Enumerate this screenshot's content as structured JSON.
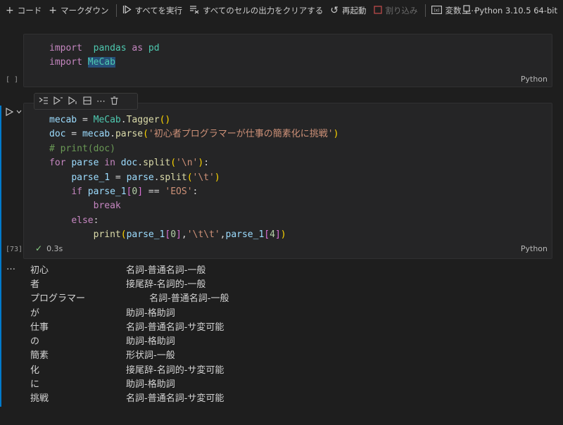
{
  "toolbar": {
    "code": "コード",
    "markdown": "マークダウン",
    "run_all": "すべてを実行",
    "clear_outputs": "すべてのセルの出力をクリアする",
    "restart": "再起動",
    "interrupt": "割り込み",
    "variables": "変数",
    "more": "⋯",
    "kernel": "Python 3.10.5 64-bit"
  },
  "cells": [
    {
      "exec_label": "[ ]",
      "language": "Python",
      "lines": [
        [
          [
            "kw",
            "import"
          ],
          [
            "",
            "  "
          ],
          [
            "mod",
            "pandas"
          ],
          [
            "",
            " "
          ],
          [
            "kw",
            "as"
          ],
          [
            "",
            " "
          ],
          [
            "mod",
            "pd"
          ]
        ],
        [
          [
            "kw",
            "import"
          ],
          [
            "",
            " "
          ],
          [
            "mod hl",
            "MeCab"
          ]
        ]
      ]
    },
    {
      "exec_label": "[73]",
      "language": "Python",
      "status_icon": "✓",
      "duration": "0.3s",
      "lines": [
        [
          [
            "var",
            "mecab"
          ],
          [
            "",
            " = "
          ],
          [
            "mod",
            "MeCab"
          ],
          [
            "",
            "."
          ],
          [
            "fn",
            "Tagger"
          ],
          [
            "br",
            "()"
          ]
        ],
        [
          [
            "var",
            "doc"
          ],
          [
            "",
            " = "
          ],
          [
            "var",
            "mecab"
          ],
          [
            "",
            "."
          ],
          [
            "fn",
            "parse"
          ],
          [
            "br",
            "("
          ],
          [
            "str",
            "'初心者プログラマーが仕事の簡素化に挑戦'"
          ],
          [
            "br",
            ")"
          ]
        ],
        [
          [
            "cm",
            "# print(doc)"
          ]
        ],
        [
          [
            "kw",
            "for"
          ],
          [
            "",
            " "
          ],
          [
            "var",
            "parse"
          ],
          [
            "",
            " "
          ],
          [
            "kw",
            "in"
          ],
          [
            "",
            " "
          ],
          [
            "var",
            "doc"
          ],
          [
            "",
            "."
          ],
          [
            "fn",
            "split"
          ],
          [
            "br",
            "("
          ],
          [
            "str",
            "'\\n'"
          ],
          [
            "br",
            ")"
          ],
          [
            "",
            ":"
          ]
        ],
        [
          [
            "",
            "    "
          ],
          [
            "var",
            "parse_1"
          ],
          [
            "",
            " = "
          ],
          [
            "var",
            "parse"
          ],
          [
            "",
            "."
          ],
          [
            "fn",
            "split"
          ],
          [
            "br",
            "("
          ],
          [
            "str",
            "'\\t'"
          ],
          [
            "br",
            ")"
          ]
        ],
        [
          [
            "",
            "    "
          ],
          [
            "kw",
            "if"
          ],
          [
            "",
            " "
          ],
          [
            "var",
            "parse_1"
          ],
          [
            "br2",
            "["
          ],
          [
            "num",
            "0"
          ],
          [
            "br2",
            "]"
          ],
          [
            "",
            " == "
          ],
          [
            "str",
            "'EOS'"
          ],
          [
            "",
            ":"
          ]
        ],
        [
          [
            "",
            "        "
          ],
          [
            "kw",
            "break"
          ]
        ],
        [
          [
            "",
            "    "
          ],
          [
            "kw",
            "else"
          ],
          [
            "",
            ":"
          ]
        ],
        [
          [
            "",
            "        "
          ],
          [
            "fn",
            "print"
          ],
          [
            "br",
            "("
          ],
          [
            "var",
            "parse_1"
          ],
          [
            "br2",
            "["
          ],
          [
            "num",
            "0"
          ],
          [
            "br2",
            "]"
          ],
          [
            "",
            ","
          ],
          [
            "str",
            "'\\t\\t'"
          ],
          [
            "",
            ","
          ],
          [
            "var",
            "parse_1"
          ],
          [
            "br2",
            "["
          ],
          [
            "num",
            "4"
          ],
          [
            "br2",
            "]"
          ],
          [
            "br",
            ")"
          ]
        ]
      ]
    }
  ],
  "cell_toolbar_icons": [
    "execute-above-icon",
    "run-by-line-icon",
    "execute-below-icon",
    "split-cell-icon",
    "more-icon",
    "delete-icon"
  ],
  "output": {
    "ellipsis": "…",
    "rows": [
      [
        "初心",
        "名詞-普通名詞-一般"
      ],
      [
        "者",
        "接尾辞-名詞的-一般"
      ],
      [
        "プログラマー",
        "\t名詞-普通名詞-一般"
      ],
      [
        "が",
        "助詞-格助詞"
      ],
      [
        "仕事",
        "名詞-普通名詞-サ変可能"
      ],
      [
        "の",
        "助詞-格助詞"
      ],
      [
        "簡素",
        "形状詞-一般"
      ],
      [
        "化",
        "接尾辞-名詞的-サ変可能"
      ],
      [
        "に",
        "助詞-格助詞"
      ],
      [
        "挑戦",
        "名詞-普通名詞-サ変可能"
      ]
    ]
  },
  "colors": {
    "background": "#1e1e1e",
    "cell_background": "#252526",
    "focus_accent": "#007acc",
    "keyword": "#c586c0",
    "string": "#ce9178",
    "comment": "#6a9955",
    "function": "#dcdcaa",
    "variable": "#9cdcfe",
    "module": "#4ec9b0",
    "success": "#89d185"
  }
}
